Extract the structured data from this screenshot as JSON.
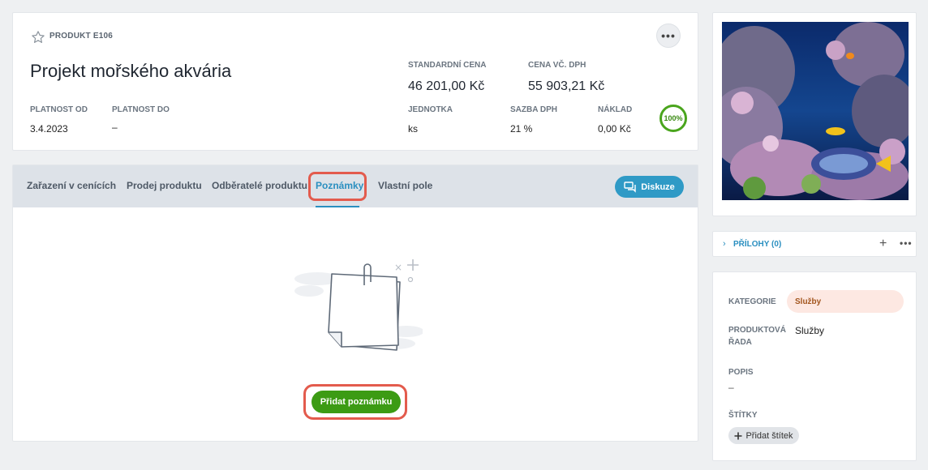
{
  "product": {
    "code": "PRODUKT E106",
    "title": "Projekt mořského akvária",
    "more_label": "•••"
  },
  "validity": {
    "from_label": "PLATNOST OD",
    "from_value": "3.4.2023",
    "to_label": "PLATNOST DO",
    "to_value": "–"
  },
  "pricing": {
    "standard_label": "STANDARDNÍ CENA",
    "standard_value": "46 201,00 Kč",
    "vat_price_label": "CENA VČ. DPH",
    "vat_price_value": "55 903,21 Kč",
    "unit_label": "JEDNOTKA",
    "unit_value": "ks",
    "vat_rate_label": "SAZBA DPH",
    "vat_rate_value": "21 %",
    "cost_label": "NÁKLAD",
    "cost_value": "0,00 Kč",
    "margin_percent": "100%"
  },
  "tabs": [
    {
      "label": "Zařazení v cenících"
    },
    {
      "label": "Prodej produktu"
    },
    {
      "label": "Odběratelé produktu"
    },
    {
      "label": "Poznámky",
      "active": true
    },
    {
      "label": "Vlastní pole"
    }
  ],
  "discussion_label": "Diskuze",
  "add_note_label": "Přidat poznámku",
  "attachments": {
    "label": "PŘÍLOHY (0)",
    "chevron": "›",
    "add": "+",
    "more": "•••"
  },
  "details": {
    "category_label": "KATEGORIE",
    "category_value": "Služby",
    "line_label_1": "PRODUKTOVÁ",
    "line_label_2": "ŘADA",
    "line_value": "Služby",
    "description_label": "POPIS",
    "description_value": "–",
    "tags_label": "ŠTÍTKY",
    "add_tag_label": "Přidat štítek"
  },
  "colors": {
    "accent": "#2a8fc0",
    "success": "#3c9b14",
    "highlight": "#e35b4d",
    "category_chip": "#fde8e2"
  },
  "icons": {
    "favorite": "star-icon",
    "discussion": "chat-icon",
    "add_tag": "plus-icon"
  }
}
